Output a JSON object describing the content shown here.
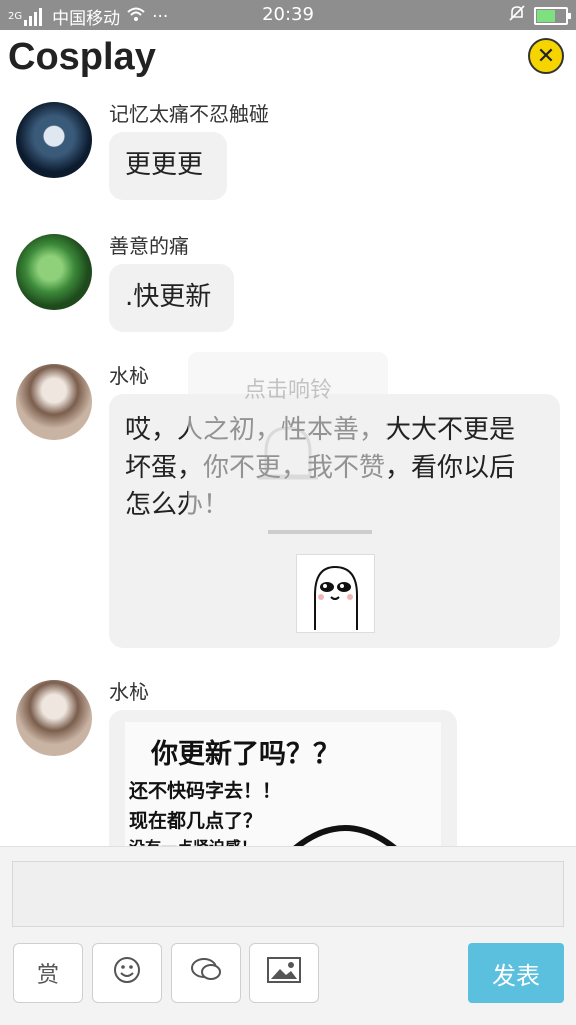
{
  "status_bar": {
    "carrier": "中国移动",
    "signal_prefix": "2G",
    "time": "20:39",
    "more": "···"
  },
  "header": {
    "title": "Cosplay"
  },
  "comments": [
    {
      "user": "记忆太痛不忍触碰",
      "text": "更更更"
    },
    {
      "user": "善意的痛",
      "text": ".快更新"
    },
    {
      "user": "水杺",
      "text": "哎，人之初，性本善，大大不更是坏蛋，你不更，我不赞，看你以后怎么办！"
    },
    {
      "user": "水杺"
    }
  ],
  "meme": {
    "line1": "你更新了吗？？",
    "line2": "还不快码字去！！",
    "line3": "现在都几点了？",
    "line4": "没有一点紧迫感！"
  },
  "overlay": {
    "text": "点击响铃"
  },
  "composer": {
    "reward_label": "赏",
    "send_label": "发表"
  }
}
